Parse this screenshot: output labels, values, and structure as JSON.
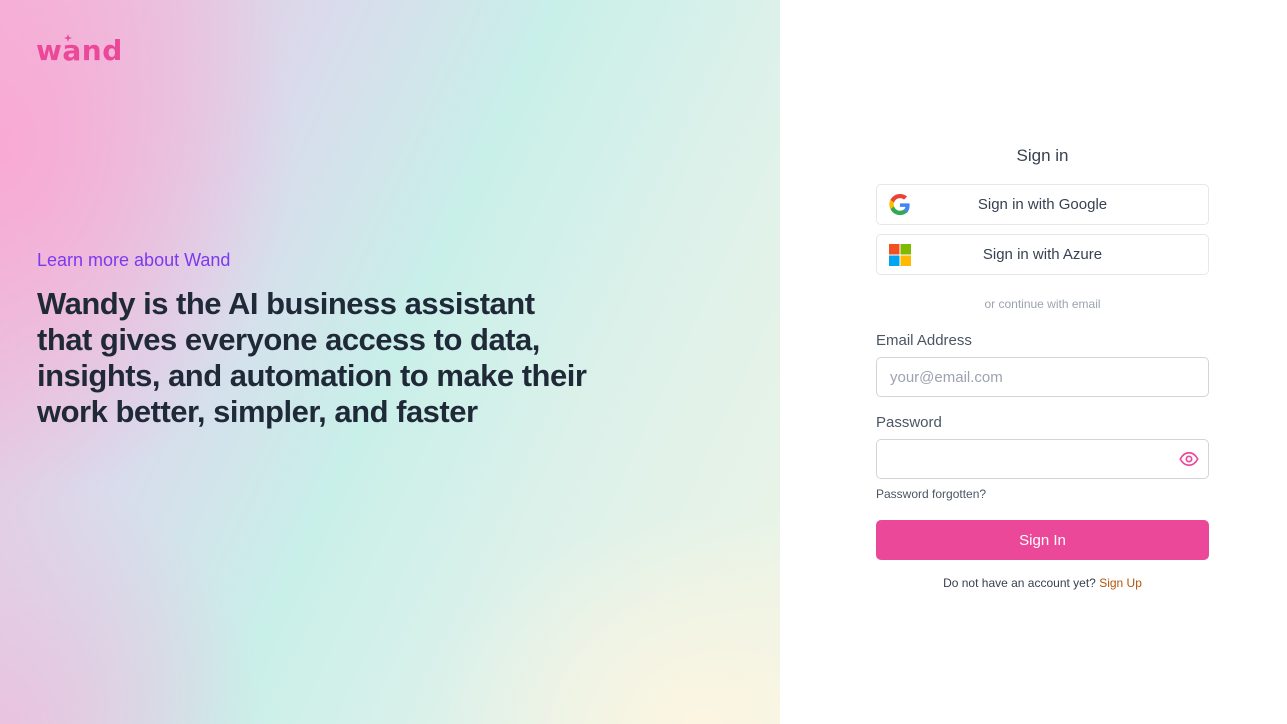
{
  "brand": {
    "logo_text": "wand",
    "accent_color": "#ec4899"
  },
  "hero": {
    "learn_more": "Learn more about Wand",
    "headline": "Wandy is the AI business assistant that gives everyone access to data, insights, and automation to make their work better, simpler, and faster"
  },
  "signin": {
    "title": "Sign in",
    "google_label": "Sign in with Google",
    "azure_label": "Sign in with Azure",
    "divider_text": "or continue with email",
    "email_label": "Email Address",
    "email_placeholder": "your@email.com",
    "email_value": "",
    "password_label": "Password",
    "password_value": "",
    "forgot_label": "Password forgotten?",
    "submit_label": "Sign In",
    "no_account_text": "Do not have an account yet?",
    "signup_label": "Sign Up"
  },
  "icons": {
    "google": "google-icon",
    "azure": "microsoft-icon",
    "show_password": "eye-icon"
  }
}
